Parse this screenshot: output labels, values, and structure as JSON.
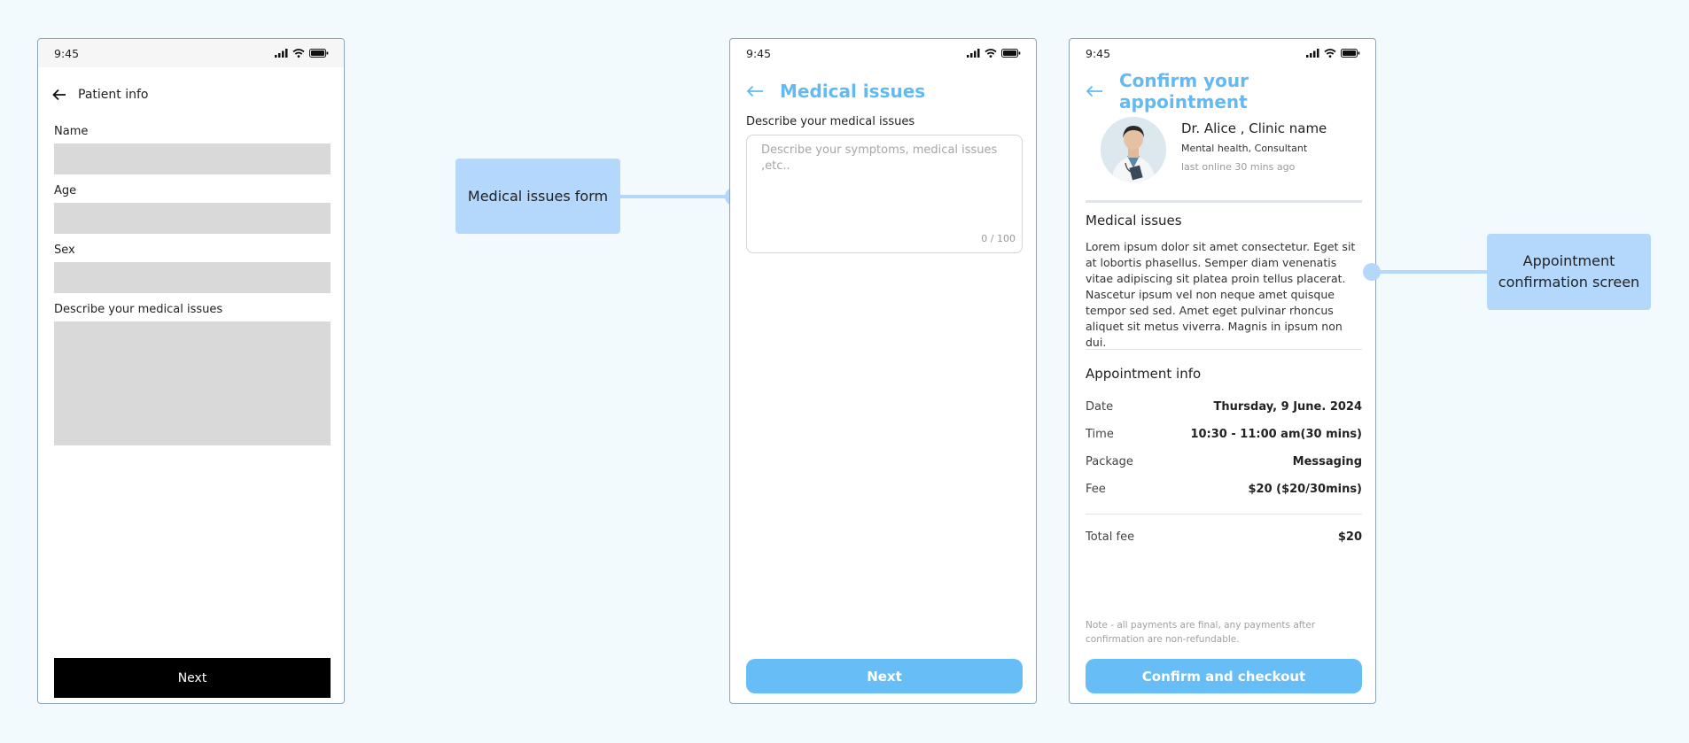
{
  "colors": {
    "accent": "#63b9f2",
    "callout": "#b4d7fc",
    "background": "#f3fafd"
  },
  "patient_screen": {
    "status_time": "9:45",
    "title": "Patient info",
    "fields": {
      "name": "Name",
      "age": "Age",
      "sex": "Sex",
      "issues": "Describe your medical issues"
    },
    "next_label": "Next"
  },
  "issues_screen": {
    "status_time": "9:45",
    "title": "Medical issues",
    "field_label": "Describe your medical issues",
    "placeholder": "Describe your symptoms, medical issues ,etc..",
    "counter": "0 / 100",
    "next_label": "Next"
  },
  "confirm_screen": {
    "status_time": "9:45",
    "title": "Confirm your appointment",
    "doctor": {
      "name": "Dr. Alice , Clinic name",
      "specialty": "Mental health, Consultant",
      "last_online": "last online 30 mins ago"
    },
    "issues_title": "Medical issues",
    "issues_text": "Lorem ipsum dolor sit amet consectetur. Eget sit at lobortis phasellus. Semper diam venenatis vitae adipiscing sit platea proin tellus placerat. Nascetur ipsum vel non neque amet quisque tempor sed sed. Amet eget pulvinar rhoncus aliquet sit metus viverra. Magnis in ipsum non dui.",
    "info_title": "Appointment info",
    "rows": [
      {
        "label": "Date",
        "value": "Thursday, 9 June. 2024"
      },
      {
        "label": "Time",
        "value": "10:30 - 11:00 am(30 mins)"
      },
      {
        "label": "Package",
        "value": "Messaging"
      },
      {
        "label": "Fee",
        "value": "$20 ($20/30mins)"
      }
    ],
    "total_label": "Total fee",
    "total_value": "$20",
    "note": "Note - all payments are final, any payments after confirmation are non-refundable.",
    "confirm_label": "Confirm and checkout"
  },
  "callouts": {
    "left": "Medical issues form",
    "right": "Appointment confirmation screen"
  },
  "icons": [
    "signal-icon",
    "wifi-icon",
    "battery-icon",
    "back-arrow-icon"
  ]
}
